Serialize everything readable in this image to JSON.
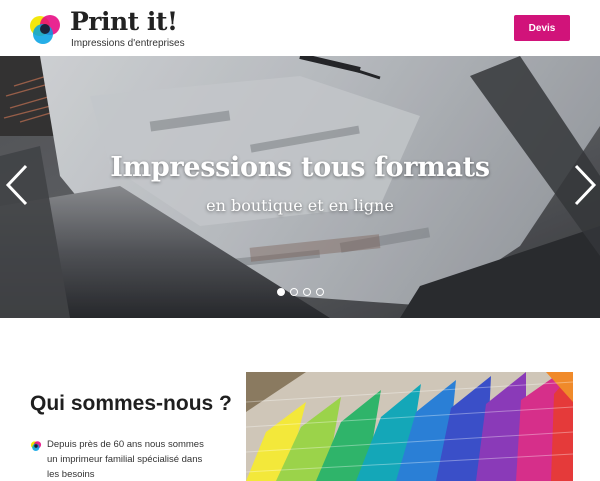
{
  "header": {
    "brand_title": "Print it!",
    "brand_subtitle": "Impressions d'entreprises",
    "devis_label": "Devis",
    "accent_color": "#d1137a"
  },
  "hero": {
    "title": "Impressions tous formats",
    "subtitle": "en boutique et en ligne",
    "slide_count": 4,
    "active_slide": 1,
    "prev_icon": "chevron-left-icon",
    "next_icon": "chevron-right-icon"
  },
  "about": {
    "title": "Qui sommes-nous ?",
    "text": "Depuis près de 60 ans nous sommes un imprimeur familial spécialisé dans les besoins",
    "bullet_icon": "cmyk-circles-icon"
  }
}
